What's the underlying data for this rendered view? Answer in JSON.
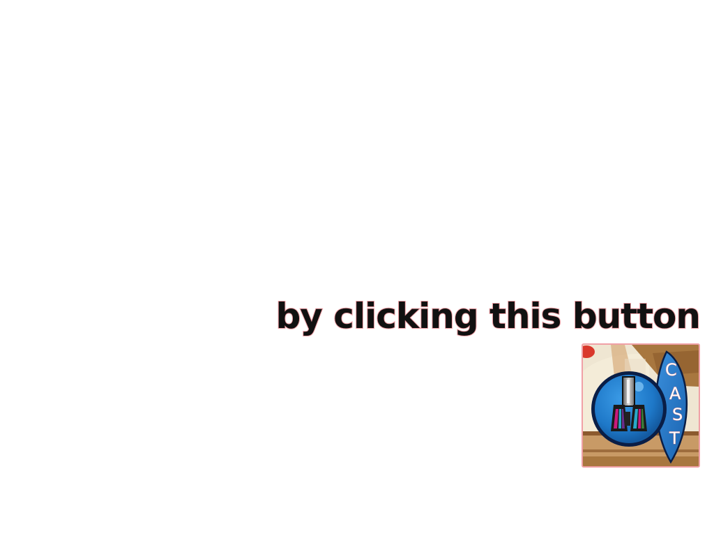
{
  "caption": {
    "text": "by clicking this button"
  },
  "cast_button": {
    "icon": "binoculars-cast-icon",
    "letters": [
      "C",
      "A",
      "S",
      "T"
    ],
    "colors": {
      "border": "#f0a0a6",
      "lens": "#1e78c8",
      "outline": "#0a1e46"
    }
  }
}
